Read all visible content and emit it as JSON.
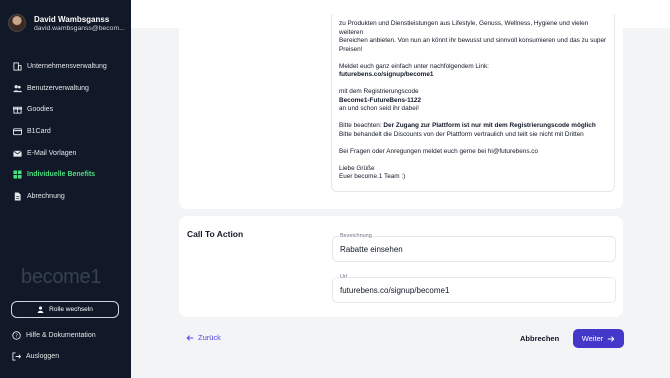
{
  "user": {
    "name": "David Wambsganss",
    "email": "david.wambsganss@becom..."
  },
  "nav": [
    {
      "label": "Unternehmensverwaltung",
      "icon": "building-icon"
    },
    {
      "label": "Benutzerverwaltung",
      "icon": "users-icon"
    },
    {
      "label": "Goodies",
      "icon": "gift-icon"
    },
    {
      "label": "B1Card",
      "icon": "credit-card-icon"
    },
    {
      "label": "E-Mail Vorlagen",
      "icon": "mail-icon"
    },
    {
      "label": "Individuelle Benefits",
      "icon": "grid-icon",
      "active": true
    },
    {
      "label": "Abrechnung",
      "icon": "document-icon"
    }
  ],
  "logo": "become1",
  "role_button": "Rolle wechseln",
  "help_link": "Hilfe & Dokumentation",
  "logout_link": "Ausloggen",
  "message": {
    "line1": "zu Produkten und Dienstleistungen aus Lifestyle, Genuss, Wellness, Hygiene und vielen weiteren",
    "line2": "Bereichen anbieten. Von nun an könnt ihr bewusst und sinnvoll konsumieren und das zu super",
    "line3": "Preisen!",
    "line4": "Meldet euch ganz einfach unter nachfolgendem Link:",
    "link": "futurebens.co/signup/become1",
    "line5": "mit dem Registrierungscode",
    "code": "Become1-FutureBens-1122",
    "line6": "an und schon seid ihr dabei!",
    "note_prefix": "Bitte beachten: ",
    "note_bold": "Der Zugang zur Plattform ist nur mit dem Registrierungscode möglich",
    "line7": "Bitte behandelt die Discounts von der Plattform vertraulich und teilt sie nicht mit Dritten",
    "line8": "Bei Fragen oder Anregungen meldet euch gerne bei hi@futurebens.co",
    "line9": "Liebe Grüße",
    "line10": "Euer become.1 Team :)"
  },
  "cta": {
    "title": "Call To Action",
    "label_field_label": "Bezeichnung",
    "label_field_value": "Rabatte einsehen",
    "url_field_label": "Url",
    "url_field_value": "futurebens.co/signup/become1"
  },
  "footer": {
    "back": "Zurück",
    "cancel": "Abbrechen",
    "next": "Weiter"
  },
  "colors": {
    "sidebar": "#111827",
    "active": "#4ade80",
    "primary": "#4338ca"
  }
}
